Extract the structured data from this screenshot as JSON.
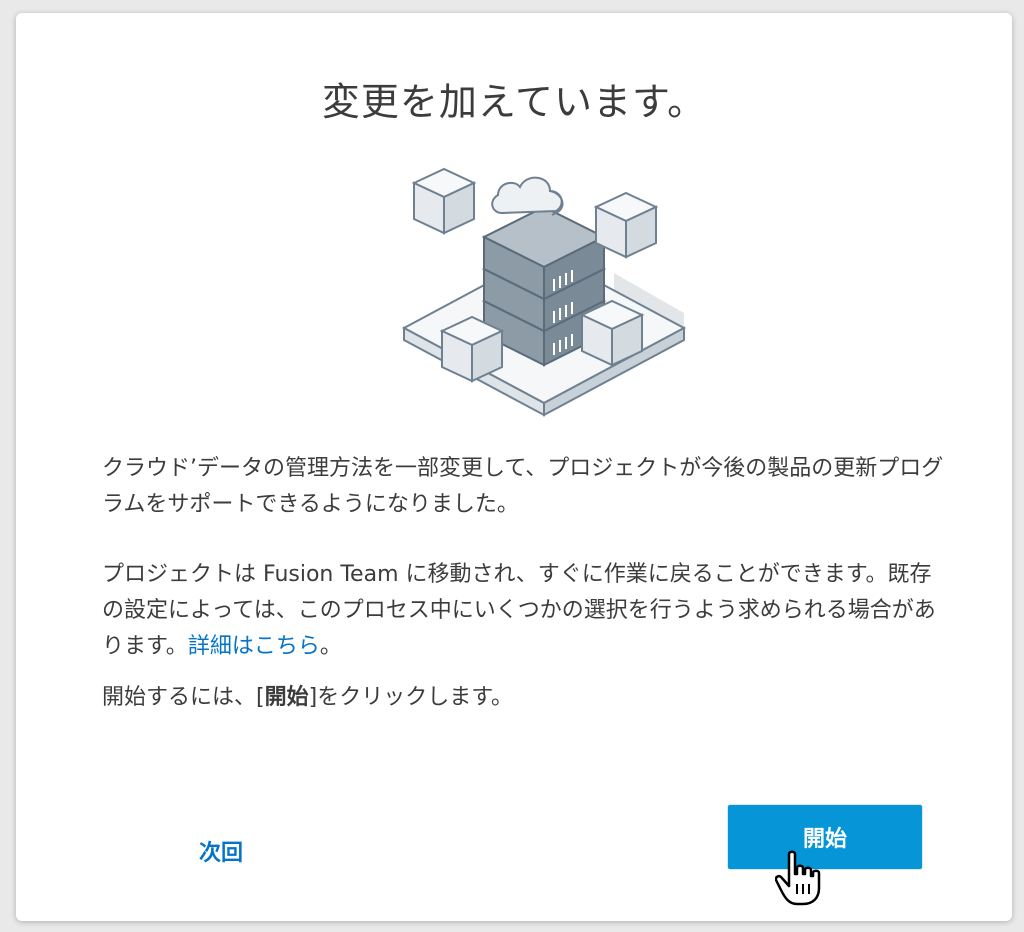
{
  "dialog": {
    "title": "変更を加えています。",
    "paragraph1": "クラウド’データの管理方法を一部変更して、プロジェクトが今後の製品の更新プログラムをサポートできるようになりました。",
    "paragraph2_text": "プロジェクトは Fusion Team に移動され、すぐに作業に戻ることができます。既存の設定によっては、このプロセス中にいくつかの選択を行うよう求められる場合があります。",
    "paragraph2_link": "詳細はこちら",
    "paragraph2_end": "。",
    "paragraph3_pre": "開始するには、[",
    "paragraph3_bold": "開始",
    "paragraph3_post": "]をクリックします。"
  },
  "buttons": {
    "later_label": "次回",
    "start_label": "開始"
  },
  "colors": {
    "accent": "#0696d7",
    "link": "#0674c6",
    "text": "#3c3c3c"
  },
  "icons": {
    "illustration": "cloud-server-illustration",
    "cursor": "hand-pointer-icon"
  }
}
